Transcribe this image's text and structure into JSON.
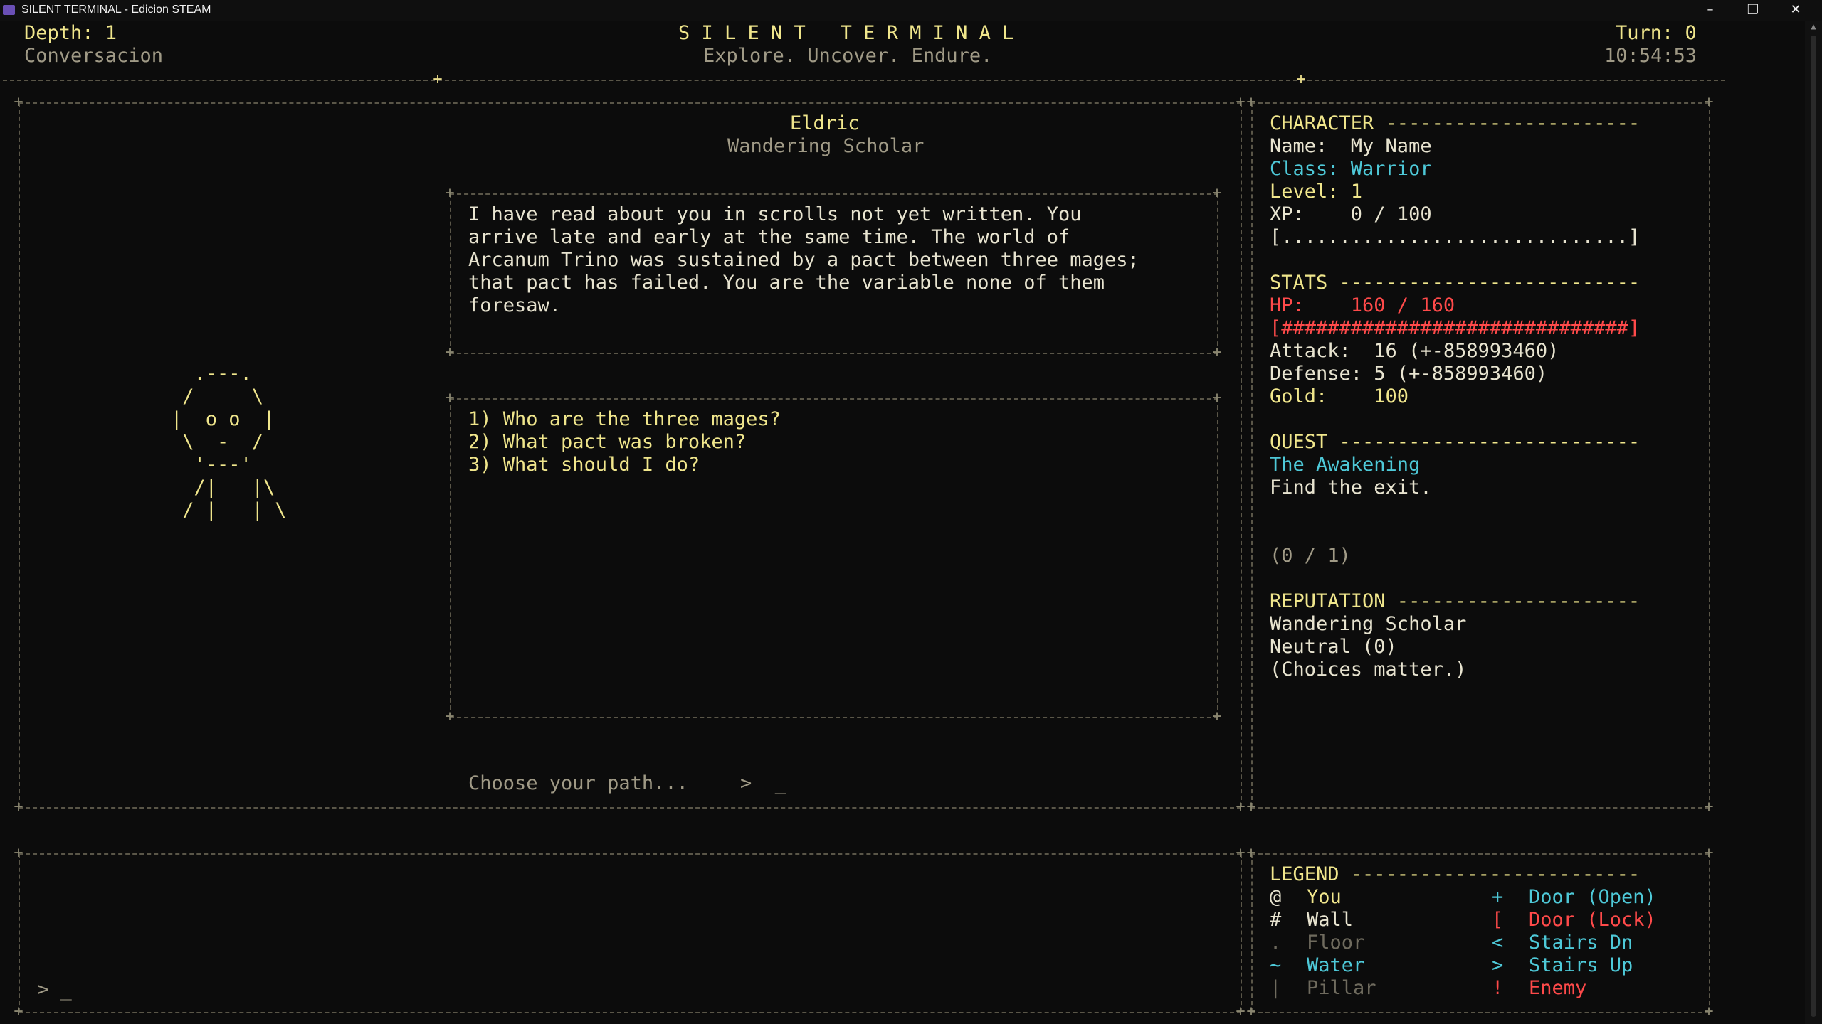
{
  "window": {
    "title": "SILENT TERMINAL - Edicion STEAM",
    "minimize": "–",
    "restore": "❐",
    "close": "✕"
  },
  "header": {
    "depth": "Depth: 1",
    "mode": "Conversacion",
    "game_title": "S I L E N T   T E R M I N A L",
    "tagline": "Explore. Uncover. Endure.",
    "turn": "Turn: 0",
    "clock": "10:54:53"
  },
  "npc": {
    "name": "Eldric",
    "role": "Wandering Scholar",
    "portrait": [
      "  .---.",
      " /     \\",
      "|  o o  |",
      " \\  -  /",
      "  '---'",
      "  /|   |\\",
      " / |   | \\"
    ]
  },
  "dialogue": {
    "lines": [
      "I have read about you in scrolls not yet written. You",
      "arrive late and early at the same time. The world of",
      "Arcanum Trino was sustained by a pact between three mages;",
      "that pact has failed. You are the variable none of them",
      "foresaw."
    ]
  },
  "choices": [
    "1) Who are the three mages?",
    "2) What pact was broken?",
    "3) What should I do?"
  ],
  "prompt": {
    "hint": "Choose your path...",
    "cursor": ">  _",
    "log_cursor": "> _"
  },
  "character": {
    "header": "CHARACTER ----------------------",
    "name": "Name:  My Name",
    "class": "Class: Warrior",
    "level": "Level: 1",
    "xp": "XP:    0 / 100",
    "xp_bar": "[..............................]"
  },
  "stats": {
    "header": "STATS --------------------------",
    "hp": "HP:    160 / 160",
    "hp_bar": "[##############################]",
    "attack": "Attack:  16 (+-858993460)",
    "defense": "Defense: 5 (+-858993460)",
    "gold": "Gold:    100"
  },
  "quest": {
    "header": "QUEST --------------------------",
    "title": "The Awakening",
    "description": "Find the exit.",
    "progress": "(0 / 1)"
  },
  "reputation": {
    "header": "REPUTATION ---------------------",
    "faction": "Wandering Scholar",
    "standing": "Neutral (0)",
    "note": "(Choices matter.)"
  },
  "legend": {
    "header": "LEGEND -------------------------",
    "left": [
      {
        "sym": "@",
        "label": "You"
      },
      {
        "sym": "#",
        "label": "Wall"
      },
      {
        "sym": ".",
        "label": "Floor"
      },
      {
        "sym": "~",
        "label": "Water"
      },
      {
        "sym": "|",
        "label": "Pillar"
      }
    ],
    "right": [
      {
        "sym": "+",
        "label": "Door (Open)"
      },
      {
        "sym": "[",
        "label": "Door (Lock)"
      },
      {
        "sym": "<",
        "label": "Stairs Dn"
      },
      {
        "sym": ">",
        "label": "Stairs Up"
      },
      {
        "sym": "!",
        "label": "Enemy"
      }
    ]
  },
  "colors": {
    "text": "#e8e0a0",
    "cyan": "#4ec9d8",
    "red": "#ff4a4a",
    "gray": "#a09a86",
    "background": "#0c0c0c"
  }
}
